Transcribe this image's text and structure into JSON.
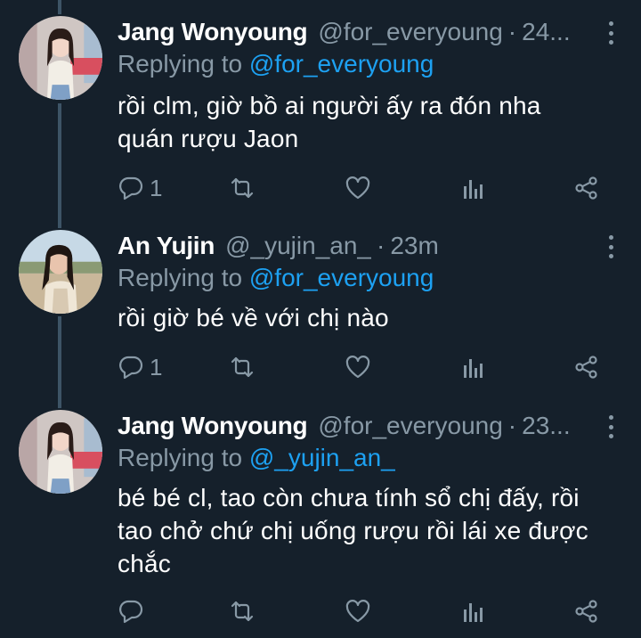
{
  "tweets": [
    {
      "name": "Jang Wonyoung",
      "handle": "@for_everyoung",
      "time": "24...",
      "replying_prefix": "Replying to",
      "replying_to": "@for_everyoung",
      "lines": [
        "rồi clm, giờ bồ ai người ấy ra đón nha",
        "quán rượu Jaon"
      ],
      "reply_count": "1",
      "avatar": "avatar-jang-wonyoung"
    },
    {
      "name": "An Yujin",
      "handle": "@_yujin_an_",
      "time": "23m",
      "replying_prefix": "Replying to",
      "replying_to": "@for_everyoung",
      "lines": [
        "rồi giờ bé về với chị nào"
      ],
      "reply_count": "1",
      "avatar": "avatar-an-yujin"
    },
    {
      "name": "Jang Wonyoung",
      "handle": "@for_everyoung",
      "time": "23...",
      "replying_prefix": "Replying to",
      "replying_to": "@_yujin_an_",
      "lines": [
        "bé bé cl, tao còn chưa tính sổ chị đấy, rồi",
        "tao chở chứ chị uống rượu rồi lái xe được",
        "chắc"
      ],
      "reply_count": "",
      "avatar": "avatar-jang-wonyoung"
    }
  ],
  "separator": "·",
  "icons": {
    "reply": "reply-icon",
    "retweet": "retweet-icon",
    "like": "heart-icon",
    "analytics": "analytics-icon",
    "share": "share-icon",
    "more": "more-options-icon"
  },
  "colors": {
    "background": "#15202b",
    "secondary_text": "#8899a6",
    "accent": "#1da1f2",
    "thread_line": "#3d5466"
  }
}
